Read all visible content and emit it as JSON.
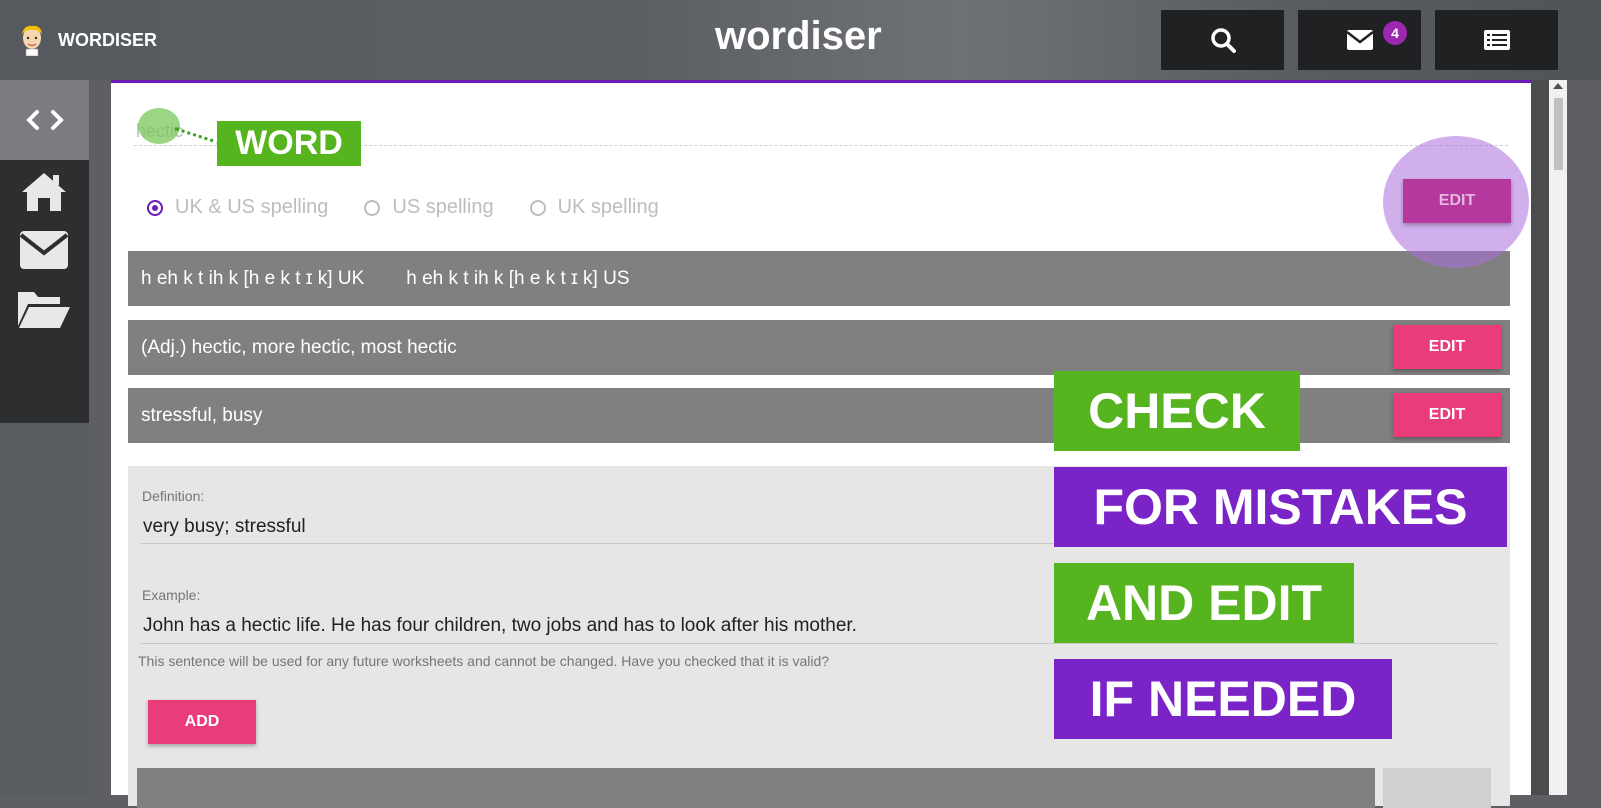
{
  "header": {
    "brand_name": "WORDISER",
    "logo_text": "wordiser",
    "messages_badge": "4"
  },
  "word": {
    "value": "hectic"
  },
  "annotations": {
    "word_tag": "WORD",
    "check": "CHECK",
    "for_mistakes": "FOR MISTAKES",
    "and_edit": "AND EDIT",
    "if_needed": "IF NEEDED"
  },
  "spelling": {
    "options": [
      "UK & US spelling",
      "US spelling",
      "UK spelling"
    ],
    "selected": "UK & US spelling"
  },
  "buttons": {
    "edit": "EDIT",
    "add": "ADD"
  },
  "pronunciation": {
    "uk": "h eh k t ih k [h e k t ɪ k] UK",
    "us": "h eh k t ih k [h e k t ɪ k] US"
  },
  "forms_text": "(Adj.) hectic, more hectic, most hectic",
  "synonyms_text": "stressful, busy",
  "definition": {
    "label": "Definition:",
    "value": "very busy; stressful"
  },
  "example": {
    "label": "Example:",
    "value": "John has a hectic life. He has four children, two jobs and has to look after his mother.",
    "hint": "This sentence will be used for any future worksheets and cannot be changed. Have you checked that it is valid?"
  },
  "colors": {
    "accent_purple": "#6a1bb8",
    "edit_pink": "#e83d7a",
    "tag_green": "#56b41e",
    "tag_purple": "#7a24c8"
  }
}
